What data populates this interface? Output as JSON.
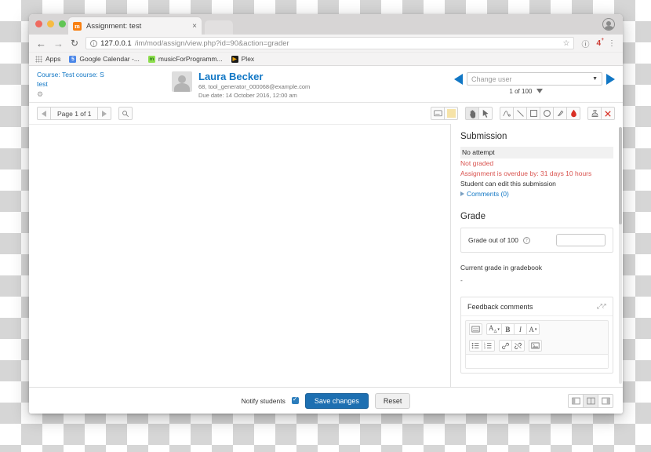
{
  "browser": {
    "tab": {
      "title": "Assignment: test",
      "favicon": "m",
      "close_label": "×"
    },
    "nav": {
      "back": "←",
      "forward": "→",
      "reload": "↻"
    },
    "omnibox": {
      "host": "127.0.0.1",
      "path": "/im/mod/assign/view.php?id=90&action=grader",
      "info_icon": "i",
      "star_icon": "☆"
    },
    "toolbar_icons": {
      "info": "ⓘ",
      "badge": "4",
      "menu": "⋮"
    },
    "bookmarks": [
      {
        "label": "Apps",
        "icon": "apps-grid"
      },
      {
        "label": "Google Calendar -...",
        "icon": "5"
      },
      {
        "label": "musicForProgramm...",
        "icon": "m"
      },
      {
        "label": "Plex",
        "icon": "▶"
      }
    ]
  },
  "moodle": {
    "breadcrumb": {
      "course": "Course: Test course: S",
      "activity": "test",
      "gear_icon": "gear-icon"
    },
    "student": {
      "name": "Laura Becker",
      "identity": "68, tool_generator_000068@example.com",
      "due_date": "Due date: 14 October 2016, 12:00 am"
    },
    "user_nav": {
      "prev_icon": "◀",
      "next_icon": "▶",
      "select_placeholder": "Change user",
      "caret": "▼",
      "count": "1 of 100",
      "filter_icon": "funnel-icon"
    },
    "pdf_toolbar": {
      "prev_page": "◀",
      "page_label": "Page 1 of 1",
      "next_page": "▶",
      "search_icon": "search-icon",
      "tools": [
        {
          "name": "comment-tool",
          "glyph": "comment"
        },
        {
          "name": "color-swatch-tool",
          "glyph": "swatch",
          "color": "#f6e3a8"
        },
        {
          "name": "pan-tool",
          "glyph": "hand",
          "active": true
        },
        {
          "name": "select-tool",
          "glyph": "cursor"
        },
        {
          "name": "pen-tool",
          "glyph": "pen"
        },
        {
          "name": "line-tool",
          "glyph": "line"
        },
        {
          "name": "rectangle-tool",
          "glyph": "square"
        },
        {
          "name": "ellipse-tool",
          "glyph": "circle"
        },
        {
          "name": "highlight-tool",
          "glyph": "highlighter"
        },
        {
          "name": "ink-color-tool",
          "glyph": "droplet",
          "color": "#d93025"
        },
        {
          "name": "stamp-tool",
          "glyph": "stamp"
        },
        {
          "name": "delete-tool",
          "glyph": "✕",
          "color": "#d93025"
        }
      ]
    },
    "submission": {
      "heading": "Submission",
      "attempt_status": "No attempt",
      "grade_status": "Not graded",
      "overdue": "Assignment is overdue by: 31 days 10 hours",
      "editable": "Student can edit this submission",
      "comments": "Comments (0)"
    },
    "grade": {
      "heading": "Grade",
      "out_of_label": "Grade out of 100",
      "help_icon": "?",
      "input_value": "",
      "current_label": "Current grade in gradebook",
      "current_value": "-"
    },
    "feedback": {
      "title": "Feedback comments",
      "expand_icon": "expand-icon",
      "toolbar_row1": [
        {
          "name": "source-code-button",
          "glyph": "▤"
        },
        {
          "name": "font-style-button",
          "glyph": "A",
          "caret": "▾"
        },
        {
          "name": "bold-button",
          "glyph": "B"
        },
        {
          "name": "italic-button",
          "glyph": "I"
        },
        {
          "name": "text-color-button",
          "glyph": "A",
          "caret": "▾"
        }
      ],
      "toolbar_row2": [
        {
          "name": "bullet-list-button",
          "glyph": "☰"
        },
        {
          "name": "numbered-list-button",
          "glyph": "≣"
        },
        {
          "name": "insert-link-button",
          "glyph": "🔗"
        },
        {
          "name": "unlink-button",
          "glyph": "🔗"
        },
        {
          "name": "insert-image-button",
          "glyph": "🖼"
        }
      ],
      "body_value": ""
    },
    "footer": {
      "notify_label": "Notify students",
      "notify_checked": true,
      "save_label": "Save changes",
      "reset_label": "Reset",
      "layout_buttons": [
        {
          "name": "layout-left-pane",
          "active": false
        },
        {
          "name": "layout-split-pane",
          "active": true
        },
        {
          "name": "layout-right-pane",
          "active": false
        }
      ]
    }
  }
}
